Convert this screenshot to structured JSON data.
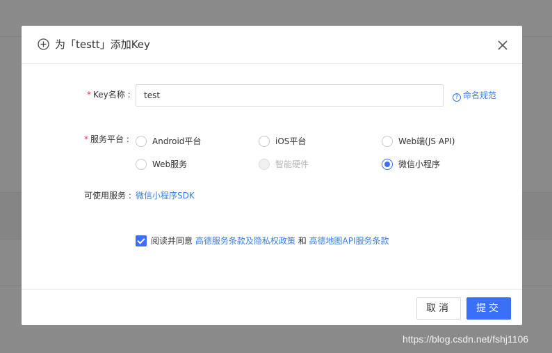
{
  "dialog": {
    "title": "为「testt」添加Key",
    "close_symbol": "×"
  },
  "form": {
    "key_name": {
      "required_mark": "*",
      "label": "Key名称 :",
      "value": "test",
      "help_link": "命名规范",
      "help_icon": "question-circle-icon"
    },
    "platform": {
      "required_mark": "*",
      "label": "服务平台 :",
      "options": [
        {
          "label": "Android平台",
          "checked": false,
          "disabled": false
        },
        {
          "label": "iOS平台",
          "checked": false,
          "disabled": false
        },
        {
          "label": "Web端(JS API)",
          "checked": false,
          "disabled": false
        },
        {
          "label": "Web服务",
          "checked": false,
          "disabled": false
        },
        {
          "label": "智能硬件",
          "checked": false,
          "disabled": true
        },
        {
          "label": "微信小程序",
          "checked": true,
          "disabled": false
        }
      ]
    },
    "available_services": {
      "label": "可使用服务 :",
      "value": "微信小程序SDK"
    },
    "agreement": {
      "checked": true,
      "prefix": "阅读并同意",
      "link1": "高德服务条款及隐私权政策",
      "conjunction": "和",
      "link2": "高德地图API服务条款"
    }
  },
  "footer": {
    "cancel_label": "取消",
    "submit_label": "提交"
  },
  "watermark": "https://blog.csdn.net/fshj1106",
  "colors": {
    "primary": "#3a6ff7",
    "link": "#3a7ce0",
    "required": "#e0393e",
    "overlay": "#8a8a8a"
  }
}
